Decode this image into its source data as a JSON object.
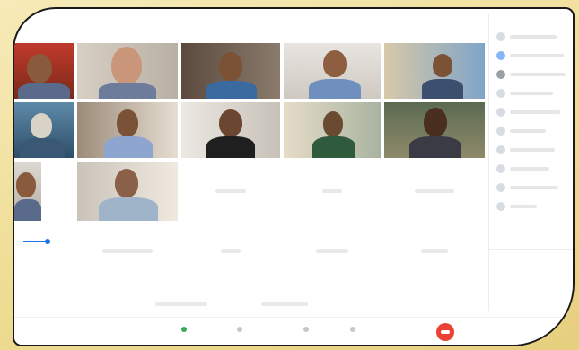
{
  "banner": {
    "title": ""
  },
  "window": {
    "topbar_text": ""
  },
  "sidebar": {
    "header": "",
    "participants": [
      {
        "label": ""
      },
      {
        "label": ""
      },
      {
        "label": ""
      },
      {
        "label": ""
      },
      {
        "label": ""
      },
      {
        "label": ""
      },
      {
        "label": ""
      },
      {
        "label": ""
      },
      {
        "label": ""
      },
      {
        "label": ""
      }
    ]
  },
  "controls": {
    "mic_label": "",
    "camera_label": "",
    "captions_label": "",
    "present_label": ""
  },
  "colors": {
    "accent": "#1a73e8",
    "end_call": "#ea4335",
    "frame": "#f4e6b0"
  }
}
